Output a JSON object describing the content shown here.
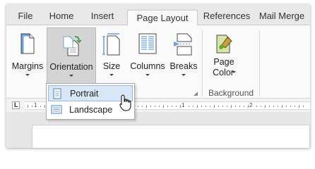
{
  "tabs": [
    {
      "label": "File",
      "active": false
    },
    {
      "label": "Home",
      "active": false
    },
    {
      "label": "Insert",
      "active": false
    },
    {
      "label": "Page Layout",
      "active": true
    },
    {
      "label": "References",
      "active": false
    },
    {
      "label": "Mail Merge",
      "active": false
    }
  ],
  "ribbon": {
    "buttons": {
      "margins": {
        "label": "Margins"
      },
      "orientation": {
        "label": "Orientation",
        "pressed": true
      },
      "size": {
        "label": "Size"
      },
      "columns": {
        "label": "Columns"
      },
      "breaks": {
        "label": "Breaks"
      },
      "page_color": {
        "label_line1": "Page",
        "label_line2": "Color"
      }
    },
    "groups": {
      "background": {
        "label": "Background"
      }
    }
  },
  "ruler": {
    "tab_icon": "L",
    "numbers": [
      "1",
      "1",
      "2"
    ]
  },
  "orientation_menu": {
    "items": [
      {
        "label": "Portrait",
        "icon": "portrait-page-icon",
        "hovered": true
      },
      {
        "label": "Landscape",
        "icon": "landscape-page-icon",
        "hovered": false
      }
    ]
  },
  "colors": {
    "accent_blue": "#3a7bc8",
    "hover_fill": "#d8e6f5",
    "pressed_fill": "#d4d4d4"
  }
}
